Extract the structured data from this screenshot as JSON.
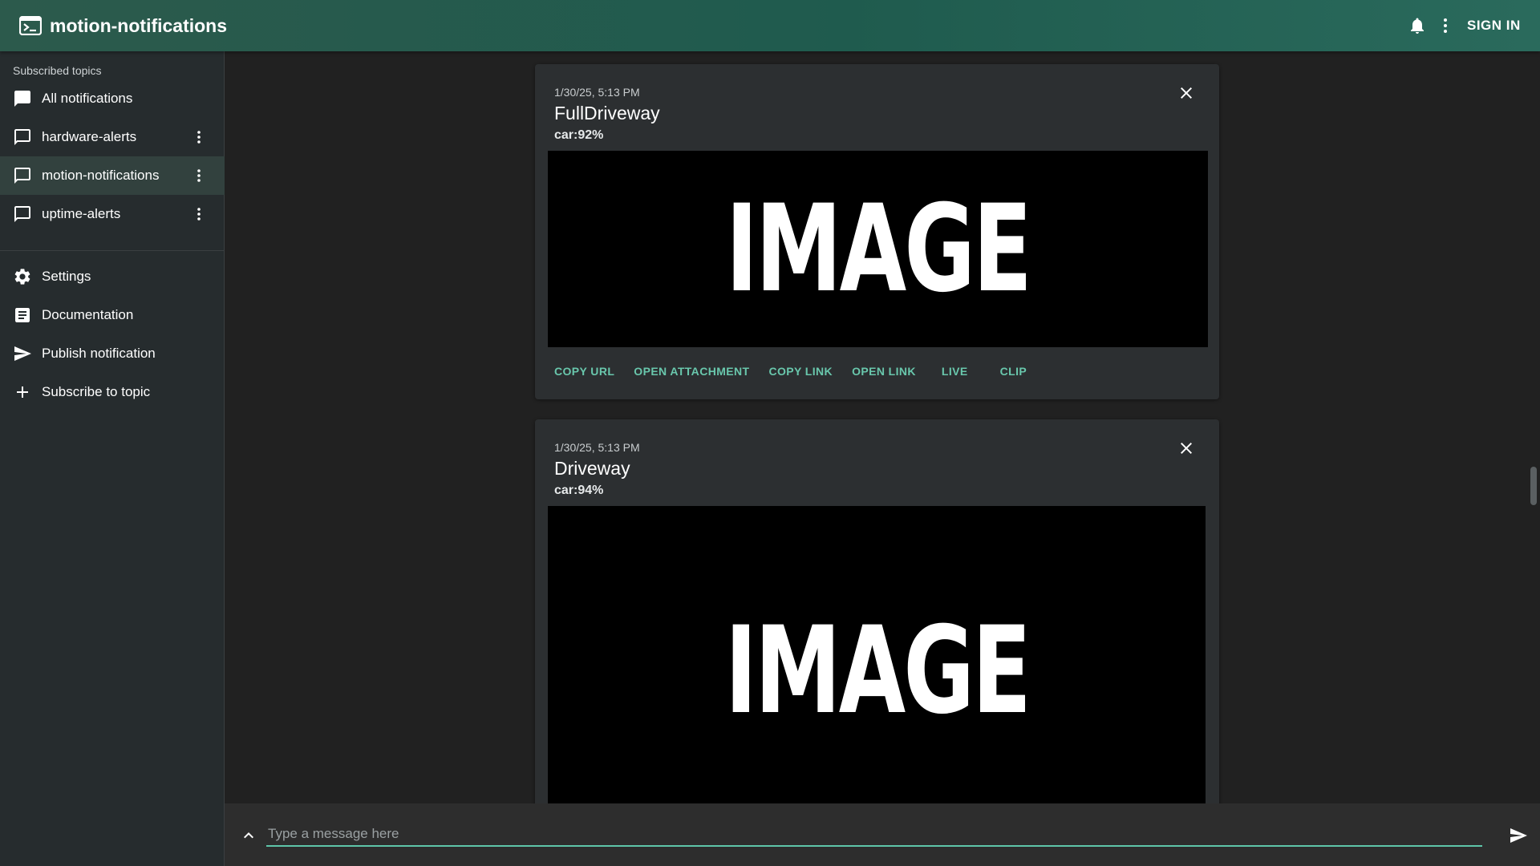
{
  "header": {
    "app_title": "motion-notifications",
    "sign_in_label": "SIGN IN",
    "icons": [
      "terminal-logo-icon",
      "bell-icon",
      "more-vert-icon"
    ]
  },
  "sidebar": {
    "section_title": "Subscribed topics",
    "topics": [
      {
        "label": "All notifications",
        "icon": "chat-filled-icon",
        "active": false
      },
      {
        "label": "hardware-alerts",
        "icon": "chat-outline-icon",
        "active": false
      },
      {
        "label": "motion-notifications",
        "icon": "chat-outline-icon",
        "active": true
      },
      {
        "label": "uptime-alerts",
        "icon": "chat-outline-icon",
        "active": false
      }
    ],
    "actions": [
      {
        "label": "Settings",
        "icon": "gear-icon"
      },
      {
        "label": "Documentation",
        "icon": "document-icon"
      },
      {
        "label": "Publish notification",
        "icon": "send-icon"
      },
      {
        "label": "Subscribe to topic",
        "icon": "plus-icon"
      }
    ]
  },
  "notifications": [
    {
      "time": "1/30/25, 5:13 PM",
      "title": "FullDriveway",
      "message": "car:92%",
      "image_text": "IMAGE",
      "actions": [
        "COPY URL",
        "OPEN ATTACHMENT",
        "COPY LINK",
        "OPEN LINK",
        "LIVE",
        "CLIP"
      ]
    },
    {
      "time": "1/30/25, 5:13 PM",
      "title": "Driveway",
      "message": "car:94%",
      "image_text": "IMAGE"
    }
  ],
  "composer": {
    "placeholder": "Type a message here",
    "value": ""
  },
  "colors": {
    "accent": "#5ec5a9",
    "appbar": "#1f5b4e",
    "sidebar_bg": "#262c2e",
    "card_bg": "#2c2f31"
  }
}
